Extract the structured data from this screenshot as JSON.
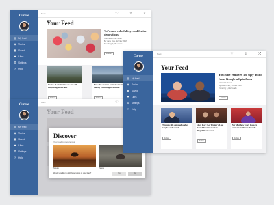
{
  "colors": {
    "sidebar": "#3a659d",
    "background": "#e9eaec"
  },
  "brand": "Curate",
  "nav": [
    {
      "label": "My feed",
      "icon": "feed-icon"
    },
    {
      "label": "Topics",
      "icon": "topics-icon"
    },
    {
      "label": "Saved",
      "icon": "bookmark-icon"
    },
    {
      "label": "Likes",
      "icon": "heart-icon"
    },
    {
      "label": "Settings",
      "icon": "gear-icon"
    },
    {
      "label": "Help",
      "icon": "help-icon"
    }
  ],
  "topbar": {
    "back": "Back",
    "icons": [
      "heart-icon",
      "share-icon",
      "shuffle-icon"
    ]
  },
  "feed_title": "Your Feed",
  "win1": {
    "lead": {
      "headline": "Tet's most colorful toys and festive decorations",
      "meta": [
        "The New York Times",
        "By Jane Doe, 12 Nov 2017",
        "Trending 2,341 reads"
      ],
      "follow": "Follow"
    },
    "cards": [
      {
        "headline": "Scores of ancient towns are still surprising historians",
        "follow": "Follow"
      },
      {
        "headline": "How the ocean's calm shores are quietly returning to normal",
        "follow": "Follow"
      }
    ]
  },
  "win2": {
    "lead": {
      "headline": "YouTube removes 1m ugly fraud from Google ad platform",
      "meta": [
        "Financial Times",
        "By Jason Lee, 14 Nov 2017",
        "Trending 5,412 reads"
      ],
      "follow": "Follow"
    },
    "cards": [
      {
        "headline": "Trump calls out media after tough week ahead",
        "follow": "Follow"
      },
      {
        "headline": "Alex Ray: Let Trump's Last Stand hurt more than Republicans have",
        "follow": "Follow"
      },
      {
        "headline": "Mr Matthew Grey leans in after the Lithium Award",
        "follow": "Follow"
      }
    ]
  },
  "discover": {
    "title": "Discover",
    "subtitle": "Your reading preferences",
    "items": [
      {
        "label": "Nature"
      },
      {
        "label": "People"
      }
    ],
    "prompt": "Would you like to add these topics to your feed?",
    "buttons": [
      "No",
      "Yes"
    ]
  }
}
